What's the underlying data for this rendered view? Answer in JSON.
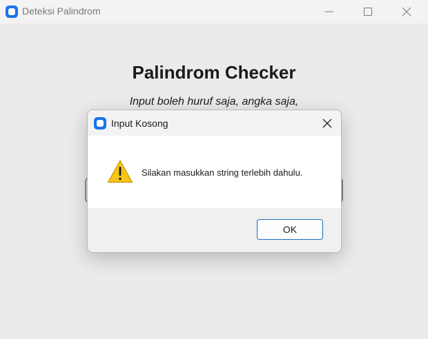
{
  "window": {
    "title": "Deteksi Palindrom",
    "app_icon": "app-icon"
  },
  "main": {
    "title": "Palindrom Checker",
    "subtitle": "Input boleh huruf saja, angka saja,"
  },
  "dialog": {
    "title": "Input Kosong",
    "message": "Silakan masukkan string terlebih dahulu.",
    "ok_label": "OK",
    "icon": "warning-icon"
  },
  "colors": {
    "accent": "#1b74e8",
    "warning": "#f5c518",
    "ok_border": "#1f6fc2"
  }
}
